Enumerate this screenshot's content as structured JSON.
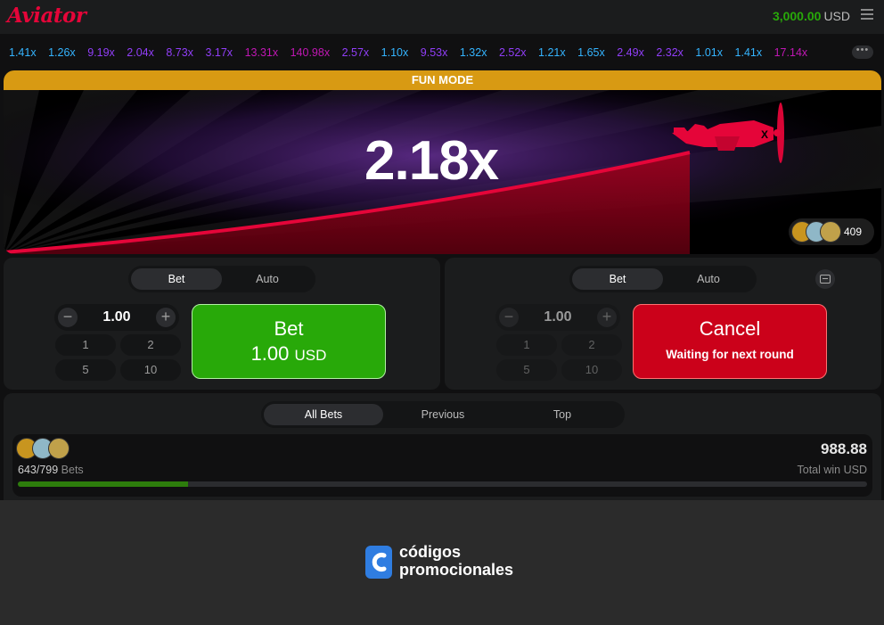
{
  "header": {
    "logo": "Aviator",
    "balance_amount": "3,000.00",
    "balance_currency": "USD",
    "menu_icon": "hamburger-menu-icon"
  },
  "history": {
    "multipliers": [
      {
        "value": "1.41x",
        "color": "#34b4ff"
      },
      {
        "value": "1.26x",
        "color": "#34b4ff"
      },
      {
        "value": "9.19x",
        "color": "#913ef8"
      },
      {
        "value": "2.04x",
        "color": "#913ef8"
      },
      {
        "value": "8.73x",
        "color": "#913ef8"
      },
      {
        "value": "3.17x",
        "color": "#913ef8"
      },
      {
        "value": "13.31x",
        "color": "#c017b4"
      },
      {
        "value": "140.98x",
        "color": "#c017b4"
      },
      {
        "value": "2.57x",
        "color": "#913ef8"
      },
      {
        "value": "1.10x",
        "color": "#34b4ff"
      },
      {
        "value": "9.53x",
        "color": "#913ef8"
      },
      {
        "value": "1.32x",
        "color": "#34b4ff"
      },
      {
        "value": "2.52x",
        "color": "#913ef8"
      },
      {
        "value": "1.21x",
        "color": "#34b4ff"
      },
      {
        "value": "1.65x",
        "color": "#34b4ff"
      },
      {
        "value": "2.49x",
        "color": "#913ef8"
      },
      {
        "value": "2.32x",
        "color": "#913ef8"
      },
      {
        "value": "1.01x",
        "color": "#34b4ff"
      },
      {
        "value": "1.41x",
        "color": "#34b4ff"
      },
      {
        "value": "17.14x",
        "color": "#c017b4"
      }
    ],
    "more_label": "•••"
  },
  "game": {
    "banner": "FUN MODE",
    "multiplier": "2.18x",
    "players_count": "409",
    "plane_color": "#e50539"
  },
  "bet_panel_1": {
    "tab_bet": "Bet",
    "tab_auto": "Auto",
    "amount": "1.00",
    "minus": "−",
    "plus": "+",
    "quick": [
      "1",
      "2",
      "5",
      "10"
    ],
    "button_line1": "Bet",
    "button_amount": "1.00",
    "button_currency": "USD"
  },
  "bet_panel_2": {
    "tab_bet": "Bet",
    "tab_auto": "Auto",
    "amount": "1.00",
    "minus": "−",
    "plus": "+",
    "quick": [
      "1",
      "2",
      "5",
      "10"
    ],
    "button_line1": "Cancel",
    "button_line2": "Waiting for next round"
  },
  "bets": {
    "tabs": [
      "All Bets",
      "Previous",
      "Top"
    ],
    "bets_count": "643/799",
    "bets_label": "Bets",
    "total_win": "988.88",
    "total_win_label": "Total win USD",
    "progress_fraction": 0.2
  },
  "brand": {
    "line1": "códigos",
    "line2": "promocionales"
  }
}
